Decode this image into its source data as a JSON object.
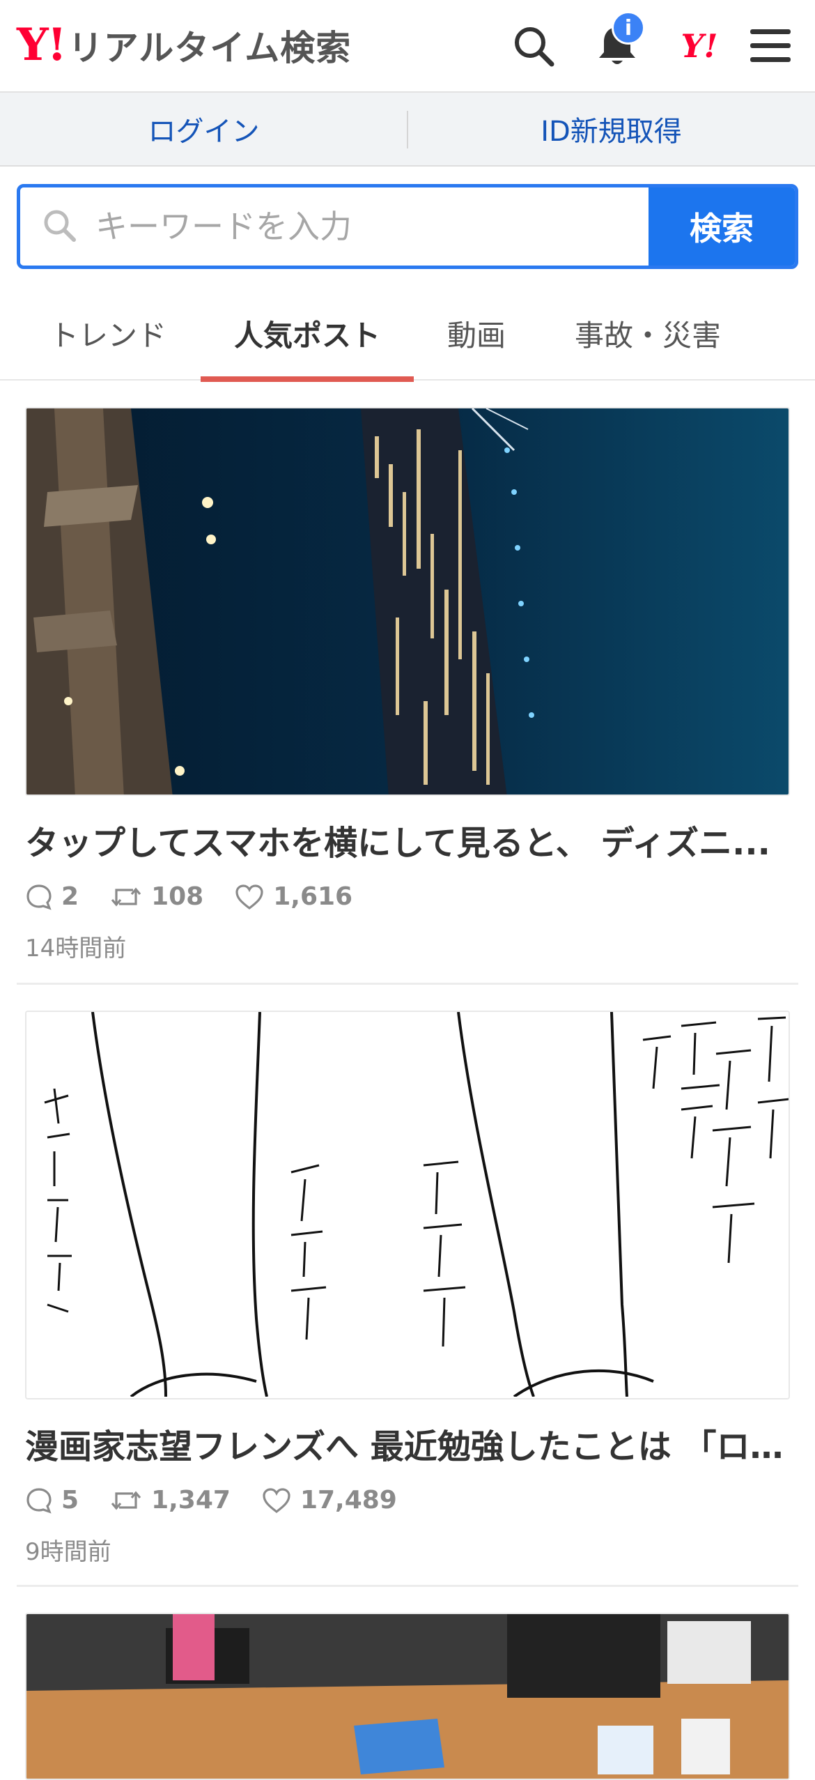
{
  "header": {
    "logo_mark": "Y!",
    "logo_text": "リアルタイム検索",
    "notification_badge": "i",
    "yj_mark": "Y!"
  },
  "account_bar": {
    "login": "ログイン",
    "signup": "ID新規取得"
  },
  "search": {
    "placeholder": "キーワードを入力",
    "button": "検索"
  },
  "tabs": [
    {
      "label": "トレンド",
      "active": false
    },
    {
      "label": "人気ポスト",
      "active": true
    },
    {
      "label": "動画",
      "active": false
    },
    {
      "label": "事故・災害",
      "active": false
    }
  ],
  "posts": [
    {
      "title": "タップしてスマホを横にして見ると、 ディズニ...",
      "replies": "2",
      "reposts": "108",
      "likes": "1,616",
      "time": "14時間前"
    },
    {
      "title": "漫画家志望フレンズへ 最近勉強したことは 「ロ...",
      "replies": "5",
      "reposts": "1,347",
      "likes": "17,489",
      "time": "9時間前"
    }
  ],
  "colors": {
    "brand_red": "#ff0033",
    "link_blue": "#1454b8",
    "search_blue": "#1c75ee",
    "tab_underline": "#e05a52"
  }
}
